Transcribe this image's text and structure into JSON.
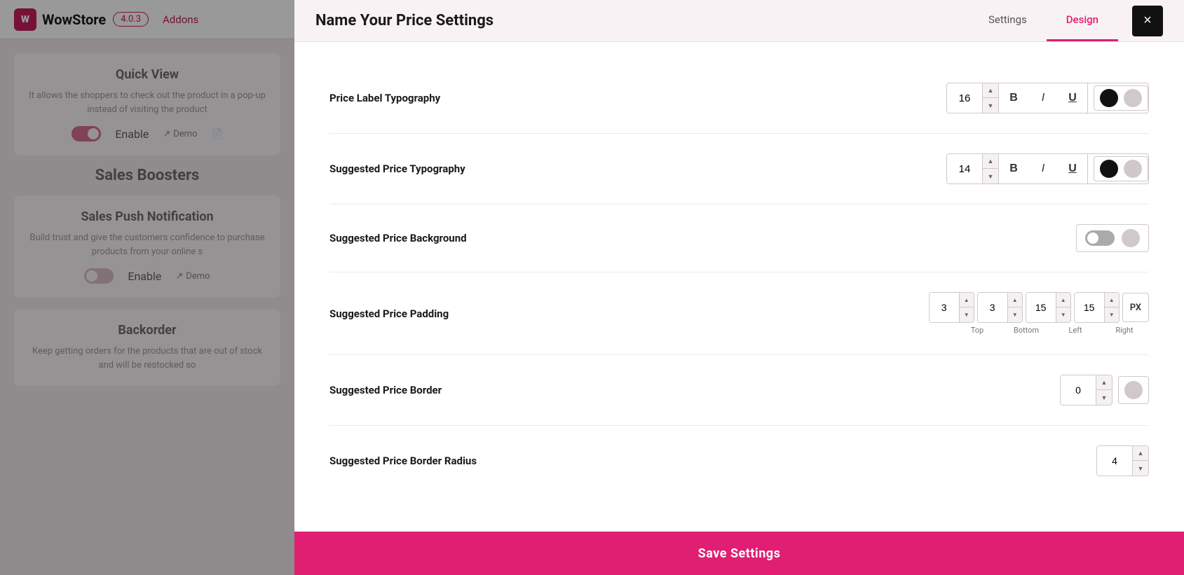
{
  "app": {
    "logo_text": "WowStore",
    "version": "4.0.3",
    "addons_label": "Addons"
  },
  "background": {
    "quick_view": {
      "title": "Quick View",
      "description": "It allows the shoppers to check out the product in a pop-up instead of visiting the product",
      "enable_label": "Enable",
      "demo_label": "Demo",
      "toggle_state": "on"
    },
    "sales_boosters_title": "Sales Boosters",
    "sales_push": {
      "title": "Sales Push Notification",
      "description": "Build trust and give the customers confidence to purchase products from your online s",
      "enable_label": "Enable",
      "demo_label": "Demo",
      "toggle_state": "off"
    },
    "backorder": {
      "title": "Backorder",
      "description": "Keep getting orders for the products that are out of stock and will be restocked so",
      "toggle_state": "off"
    }
  },
  "modal": {
    "title": "Name Your Price Settings",
    "tabs": [
      {
        "id": "settings",
        "label": "Settings",
        "active": false
      },
      {
        "id": "design",
        "label": "Design",
        "active": true
      }
    ],
    "close_label": "×"
  },
  "design_settings": {
    "price_label_typography": {
      "label": "Price Label Typography",
      "font_size": "16",
      "bold_label": "B",
      "italic_label": "I",
      "underline_label": "U",
      "color_dark": "#111111",
      "color_light": "#d0c8ca"
    },
    "suggested_price_typography": {
      "label": "Suggested Price Typography",
      "font_size": "14",
      "bold_label": "B",
      "italic_label": "I",
      "underline_label": "U",
      "color_dark": "#111111",
      "color_light": "#d0c8ca"
    },
    "suggested_price_background": {
      "label": "Suggested Price Background",
      "color_gray": "#aaaaaa",
      "color_light": "#d0c8ca"
    },
    "suggested_price_padding": {
      "label": "Suggested Price Padding",
      "top": "3",
      "bottom": "3",
      "left": "15",
      "right": "15",
      "unit": "PX",
      "top_label": "Top",
      "bottom_label": "Bottom",
      "left_label": "Left",
      "right_label": "Right"
    },
    "suggested_price_border": {
      "label": "Suggested Price Border",
      "value": "0",
      "color_light": "#d0c8ca"
    },
    "suggested_price_border_radius": {
      "label": "Suggested Price Border Radius",
      "value": "4"
    }
  },
  "save_button": {
    "label": "Save Settings"
  }
}
